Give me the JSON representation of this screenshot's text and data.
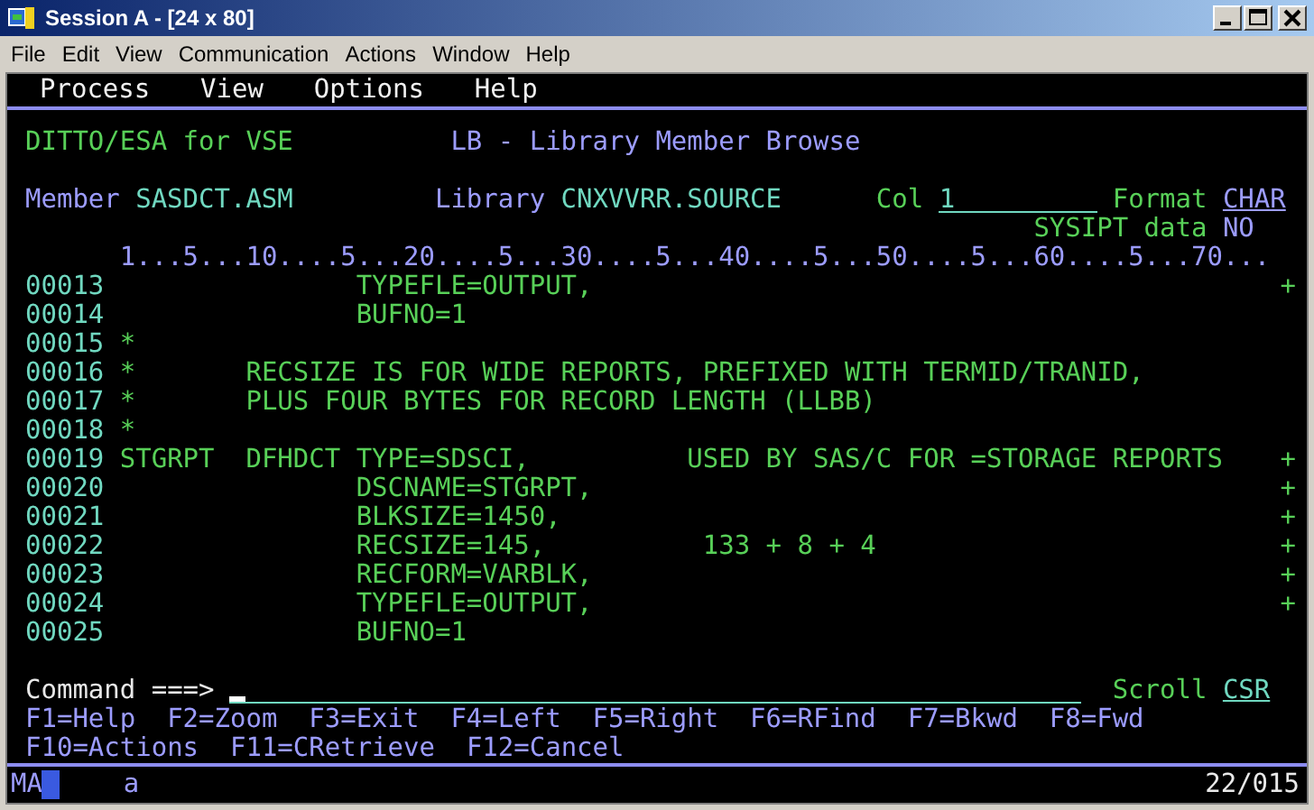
{
  "window": {
    "title": "Session A - [24 x 80]"
  },
  "menu_bar": [
    "File",
    "Edit",
    "View",
    "Communication",
    "Actions",
    "Window",
    "Help"
  ],
  "terminal": {
    "action_bar": [
      "Process",
      "View",
      "Options",
      "Help"
    ],
    "product": "DITTO/ESA for VSE",
    "panel_title": "LB - Library Member Browse",
    "member_label": "Member",
    "member": "SASDCT.ASM",
    "library_label": "Library",
    "library": "CNXVVRR.SOURCE",
    "col_label": "Col",
    "col_value": "1",
    "format_label": "Format",
    "format_value": "CHAR",
    "sysipt_label": "SYSIPT data",
    "sysipt_value": "NO",
    "ruler": "1...5...10....5...20....5...30....5...40....5...50....5...60....5...70...",
    "lines": [
      {
        "number": "00013",
        "text": "               TYPEFLE=OUTPUT,",
        "continuation": "+"
      },
      {
        "number": "00014",
        "text": "               BUFNO=1"
      },
      {
        "number": "00015",
        "text": "*"
      },
      {
        "number": "00016",
        "text": "*       RECSIZE IS FOR WIDE REPORTS, PREFIXED WITH TERMID/TRANID,"
      },
      {
        "number": "00017",
        "text": "*       PLUS FOUR BYTES FOR RECORD LENGTH (LLBB)"
      },
      {
        "number": "00018",
        "text": "*"
      },
      {
        "number": "00019",
        "text": "STGRPT  DFHDCT TYPE=SDSCI,          USED BY SAS/C FOR =STORAGE REPORTS",
        "continuation": "+"
      },
      {
        "number": "00020",
        "text": "               DSCNAME=STGRPT,",
        "continuation": "+"
      },
      {
        "number": "00021",
        "text": "               BLKSIZE=1450,",
        "continuation": "+"
      },
      {
        "number": "00022",
        "text": "               RECSIZE=145,          133 + 8 + 4",
        "continuation": "+"
      },
      {
        "number": "00023",
        "text": "               RECFORM=VARBLK,",
        "continuation": "+"
      },
      {
        "number": "00024",
        "text": "               TYPEFLE=OUTPUT,",
        "continuation": "+"
      },
      {
        "number": "00025",
        "text": "               BUFNO=1"
      }
    ],
    "command_label": "Command ===>",
    "scroll_label": "Scroll",
    "scroll_value": "CSR",
    "function_keys": [
      [
        "F1=Help",
        "F2=Zoom",
        "F3=Exit",
        "F4=Left",
        "F5=Right",
        "F6=RFind",
        "F7=Bkwd",
        "F8=Fwd"
      ],
      [
        "F10=Actions",
        "F11=CRetrieve",
        "F12=Cancel"
      ]
    ]
  },
  "status_bar": {
    "mode": "MA",
    "indicator": "a",
    "cursor_position": "22/015"
  }
}
